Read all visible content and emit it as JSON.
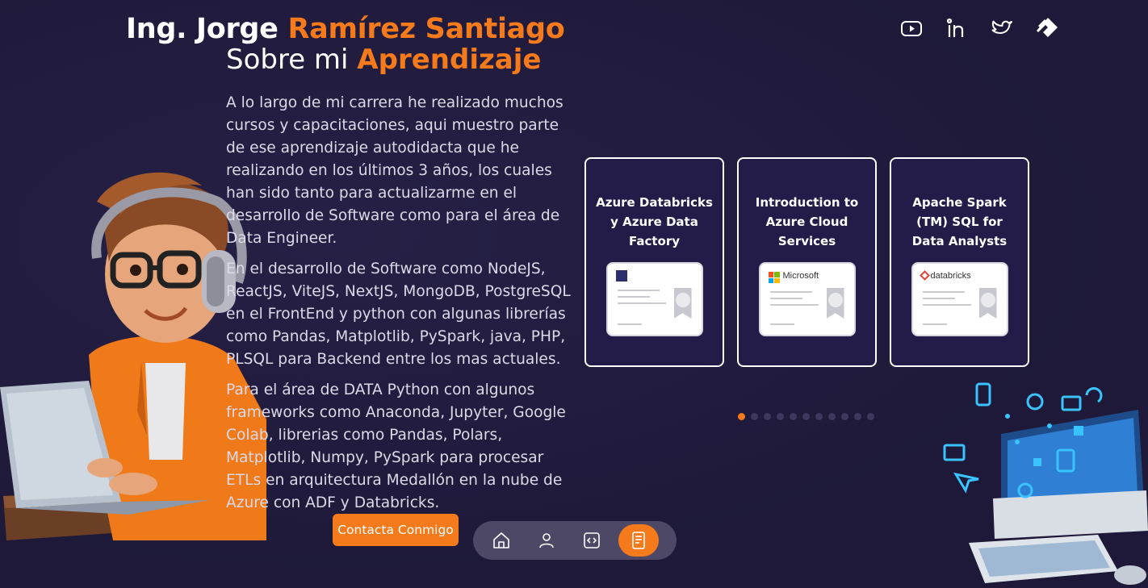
{
  "header": {
    "title_prefix": "Ing. Jorge ",
    "title_accent": "Ramírez Santiago",
    "socials": [
      {
        "icon": "youtube-icon"
      },
      {
        "icon": "linkedin-icon"
      },
      {
        "icon": "twitter-icon"
      },
      {
        "icon": "brand-logo-icon"
      }
    ]
  },
  "section": {
    "title_prefix": "Sobre mi ",
    "title_accent": "Aprendizaje",
    "paragraphs": [
      "A lo largo de mi carrera he realizado muchos cursos y capacitaciones, aqui muestro parte de ese aprendizaje autodidacta que he realizando en los últimos 3 años, los cuales han sido tanto para actualizarme en el desarrollo de Software como para el área de Data Engineer.",
      "En el desarrollo de Software como NodeJS, ReactJS, ViteJS, NextJS, MongoDB, PostgreSQL en el FrontEnd y python con algunas librerías como Pandas, Matplotlib, PySpark, java, PHP, PLSQL para Backend entre los mas actuales.",
      "Para el área de DATA Python con algunos frameworks como Anaconda, Jupyter, Google Colab, librerias como Pandas, Polars, Matplotlib, Numpy, PySpark para procesar ETLs en arquitectura Medallón en la nube de Azure con ADF y Databricks."
    ]
  },
  "cards": [
    {
      "title": "Azure Databricks y Azure Data Factory",
      "cert_logo": ""
    },
    {
      "title": "Introduction to Azure Cloud Services",
      "cert_logo": "Microsoft"
    },
    {
      "title": "Apache Spark (TM) SQL for Data Analysts",
      "cert_logo": "databricks"
    }
  ],
  "carousel": {
    "total_dots": 11,
    "active_index": 0
  },
  "cta": {
    "label": "Contacta Conmigo"
  },
  "nav": [
    {
      "icon": "home-icon",
      "active": false
    },
    {
      "icon": "user-icon",
      "active": false
    },
    {
      "icon": "code-icon",
      "active": false
    },
    {
      "icon": "book-icon",
      "active": true
    }
  ],
  "colors": {
    "accent": "#f47a1c",
    "background": "#1f1a3a",
    "card": "#231c48",
    "nav": "#4d4866"
  }
}
